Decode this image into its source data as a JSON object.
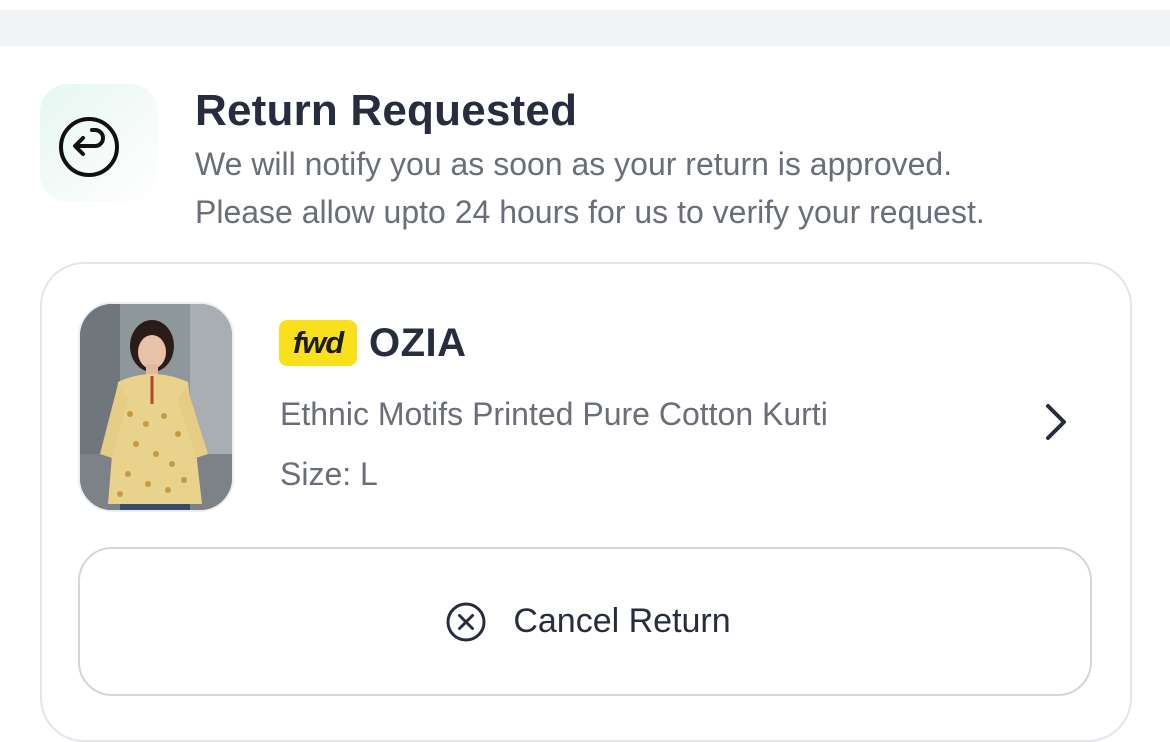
{
  "status": {
    "icon": "return-icon",
    "title": "Return Requested",
    "line1": "We will notify you as soon as your return is approved.",
    "line2": "Please allow upto 24 hours for us to verify your request."
  },
  "product": {
    "image": "kurti-product-image",
    "brand_badge": "fwd",
    "brand": "OZIA",
    "title": "Ethnic Motifs Printed Pure Cotton Kurti",
    "size": "Size: L",
    "chevron_icon": "chevron-right-icon"
  },
  "actions": {
    "cancel_label": "Cancel Return",
    "cancel_icon": "close-circle-icon"
  },
  "colors": {
    "badge_yellow": "#f8e11c",
    "text_primary": "#282c3f",
    "text_secondary": "#696e79"
  }
}
